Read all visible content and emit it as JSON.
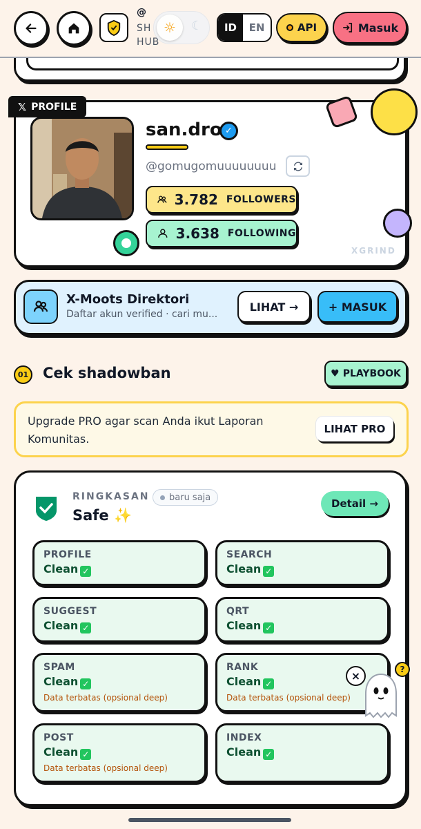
{
  "header": {
    "brand_top": "SH",
    "brand_sub": "HUB",
    "lang_id": "ID",
    "lang_en": "EN",
    "api_label": "API",
    "login_label": "Masuk"
  },
  "profile": {
    "tag": "PROFILE",
    "name": "san.dro",
    "handle": "@gomugomuuuuuuuu",
    "followers_count": "3.782",
    "followers_label": "FOLLOWERS",
    "following_count": "3.638",
    "following_label": "FOLLOWING",
    "watermark": "XGRIND"
  },
  "moots": {
    "title": "X-Moots Direktori",
    "subtitle": "Daftar akun verified · cari mu...",
    "view_label": "LIHAT →",
    "join_label": "+ MASUK"
  },
  "section": {
    "number": "01",
    "title": "Cek shadowban",
    "playbook_label": "PLAYBOOK"
  },
  "pro_notice": {
    "text": "Upgrade PRO agar scan Anda ikut Laporan Komunitas.",
    "button": "LIHAT PRO"
  },
  "summary": {
    "label": "RINGKASAN",
    "time_badge": "baru saja",
    "status": "Safe ✨",
    "detail_label": "Detail →"
  },
  "checks": [
    {
      "title": "PROFILE",
      "status": "Clean",
      "note": ""
    },
    {
      "title": "SEARCH",
      "status": "Clean",
      "note": ""
    },
    {
      "title": "SUGGEST",
      "status": "Clean",
      "note": ""
    },
    {
      "title": "QRT",
      "status": "Clean",
      "note": ""
    },
    {
      "title": "SPAM",
      "status": "Clean",
      "note": "Data terbatas (opsional deep)"
    },
    {
      "title": "RANK",
      "status": "Clean",
      "note": "Data terbatas (opsional deep)"
    },
    {
      "title": "POST",
      "status": "Clean",
      "note": "Data terbatas (opsional deep)"
    },
    {
      "title": "INDEX",
      "status": "Clean",
      "note": ""
    }
  ],
  "help_mark": "?",
  "colors": {
    "accent_red": "#f87184",
    "accent_yellow": "#fde68a",
    "accent_green": "#a7f3d0",
    "accent_blue": "#38bdf8"
  }
}
